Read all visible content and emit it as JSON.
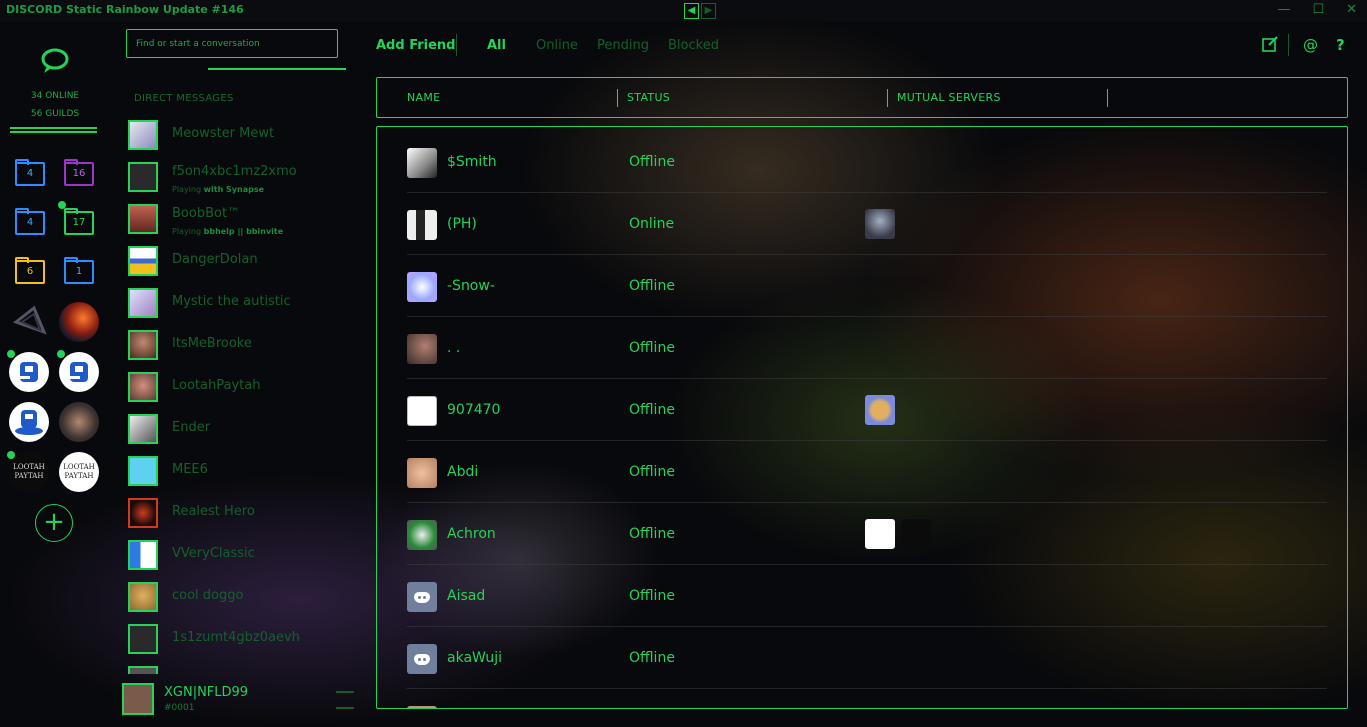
{
  "title": "DISCORD Static Rainbow Update #146",
  "guilds": {
    "online": "34 ONLINE",
    "guild_count": "56 GUILDS",
    "folders": [
      "4",
      "16",
      "4",
      "17",
      "6",
      "1"
    ],
    "logo_text": [
      "LOOTAH PAYTAH",
      "LOOTAH PAYTAH"
    ]
  },
  "dms": {
    "search_placeholder": "Find or start a conversation",
    "heading": "DIRECT MESSAGES",
    "items": [
      {
        "name": "Meowster Mewt",
        "game_prefix": "",
        "game": ""
      },
      {
        "name": "f5on4xbc1mz2xmo",
        "game_prefix": "Playing ",
        "game": "with Synapse"
      },
      {
        "name": "BoobBot™",
        "game_prefix": "Playing ",
        "game": "bbhelp || bbinvite"
      },
      {
        "name": "DangerDolan",
        "game_prefix": "",
        "game": ""
      },
      {
        "name": "Mystic the autistic",
        "game_prefix": "",
        "game": ""
      },
      {
        "name": "ItsMeBrooke",
        "game_prefix": "",
        "game": ""
      },
      {
        "name": "LootahPaytah",
        "game_prefix": "",
        "game": ""
      },
      {
        "name": "Ender",
        "game_prefix": "",
        "game": ""
      },
      {
        "name": "MEE6",
        "game_prefix": "",
        "game": ""
      },
      {
        "name": "Realest Hero",
        "game_prefix": "",
        "game": ""
      },
      {
        "name": "VVeryClassic",
        "game_prefix": "",
        "game": ""
      },
      {
        "name": "cool doggo",
        "game_prefix": "",
        "game": ""
      },
      {
        "name": "1s1zumt4gbz0aevh",
        "game_prefix": "",
        "game": ""
      }
    ],
    "user": {
      "name": "XGN|NFLD99",
      "tag": "#0001"
    }
  },
  "topnav": {
    "add_friend": "Add Friend",
    "tabs": [
      "All",
      "Online",
      "Pending",
      "Blocked"
    ]
  },
  "table": {
    "columns": [
      "NAME",
      "STATUS",
      "MUTUAL SERVERS"
    ],
    "rows": [
      {
        "name": "$Smith",
        "status": "Offline"
      },
      {
        "name": "(PH)",
        "status": "Online"
      },
      {
        "name": "-Snow-",
        "status": "Offline"
      },
      {
        "name": ". .",
        "status": "Offline"
      },
      {
        "name": "907470",
        "status": "Offline"
      },
      {
        "name": "Abdi",
        "status": "Offline"
      },
      {
        "name": "Achron",
        "status": "Offline"
      },
      {
        "name": "Aisad",
        "status": "Offline"
      },
      {
        "name": "akaWuji",
        "status": "Offline"
      }
    ]
  },
  "colors": {
    "accent": "#24d35a",
    "background": "#08090c"
  }
}
